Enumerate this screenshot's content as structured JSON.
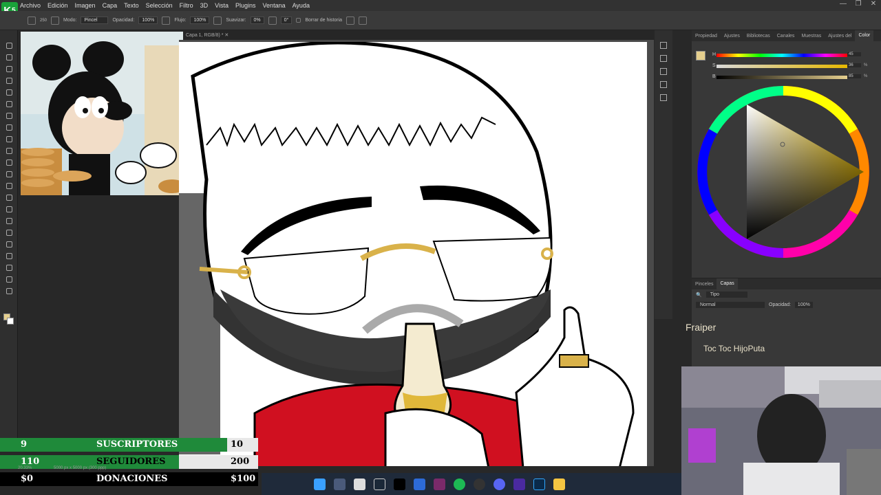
{
  "menu": {
    "items": [
      "Archivo",
      "Edición",
      "Imagen",
      "Capa",
      "Texto",
      "Selección",
      "Filtro",
      "3D",
      "Vista",
      "Plugins",
      "Ventana",
      "Ayuda"
    ]
  },
  "logo": {
    "text": "K",
    "sup": "5"
  },
  "options": {
    "mode_label": "Modo:",
    "mode_value": "Pincel",
    "opacity_label": "Opacidad:",
    "opacity_value": "100%",
    "flow_label": "Flujo:",
    "flow_value": "100%",
    "smooth_label": "Suavizar:",
    "smooth_value": "0%",
    "angle_value": "0°",
    "history_label": "Borrar de historia",
    "brush_size": "250"
  },
  "document": {
    "tab_title": "Capa 1, RGB/8) *"
  },
  "right_panel": {
    "tabs": [
      "Propiedad",
      "Ajustes",
      "Bibliotecas",
      "Canales",
      "Muestras",
      "Ajustes del",
      "Color"
    ],
    "active_tab": "Color",
    "h_label": "H",
    "h_value": "45",
    "h_level": 0.12,
    "s_label": "S",
    "s_value": "36",
    "s_pct": "%",
    "s_level": 0.36,
    "b_label": "B",
    "b_value": "85",
    "b_pct": "%",
    "b_level": 0.85,
    "fg_color": "#e5cf8e"
  },
  "layers_panel": {
    "tabs": [
      "Pinceles",
      "Capas"
    ],
    "active_tab": "Capas",
    "filter_label": "Tipo",
    "blend_mode": "Normal",
    "opacity_label": "Opacidad:",
    "opacity_value": "100%"
  },
  "alert": {
    "name": "Fraiper",
    "message": "Toc Toc HijoPuta"
  },
  "stats": [
    {
      "a": "9",
      "label": "SUSCRIPTORES",
      "b": "10",
      "color": "#1f8a3a",
      "progress": 0.9
    },
    {
      "a": "110",
      "label": "SEGUIDORES",
      "b": "200",
      "color": "#1f8a3a",
      "progress": 0.55
    },
    {
      "a": "$0",
      "label": "DONACIONES",
      "b": "$100",
      "color": "#1f8a3a",
      "progress": 0.0
    }
  ],
  "status": {
    "zoom": "20.33%",
    "doc_size": "5000 px x 5000 px (300 ppp)"
  }
}
